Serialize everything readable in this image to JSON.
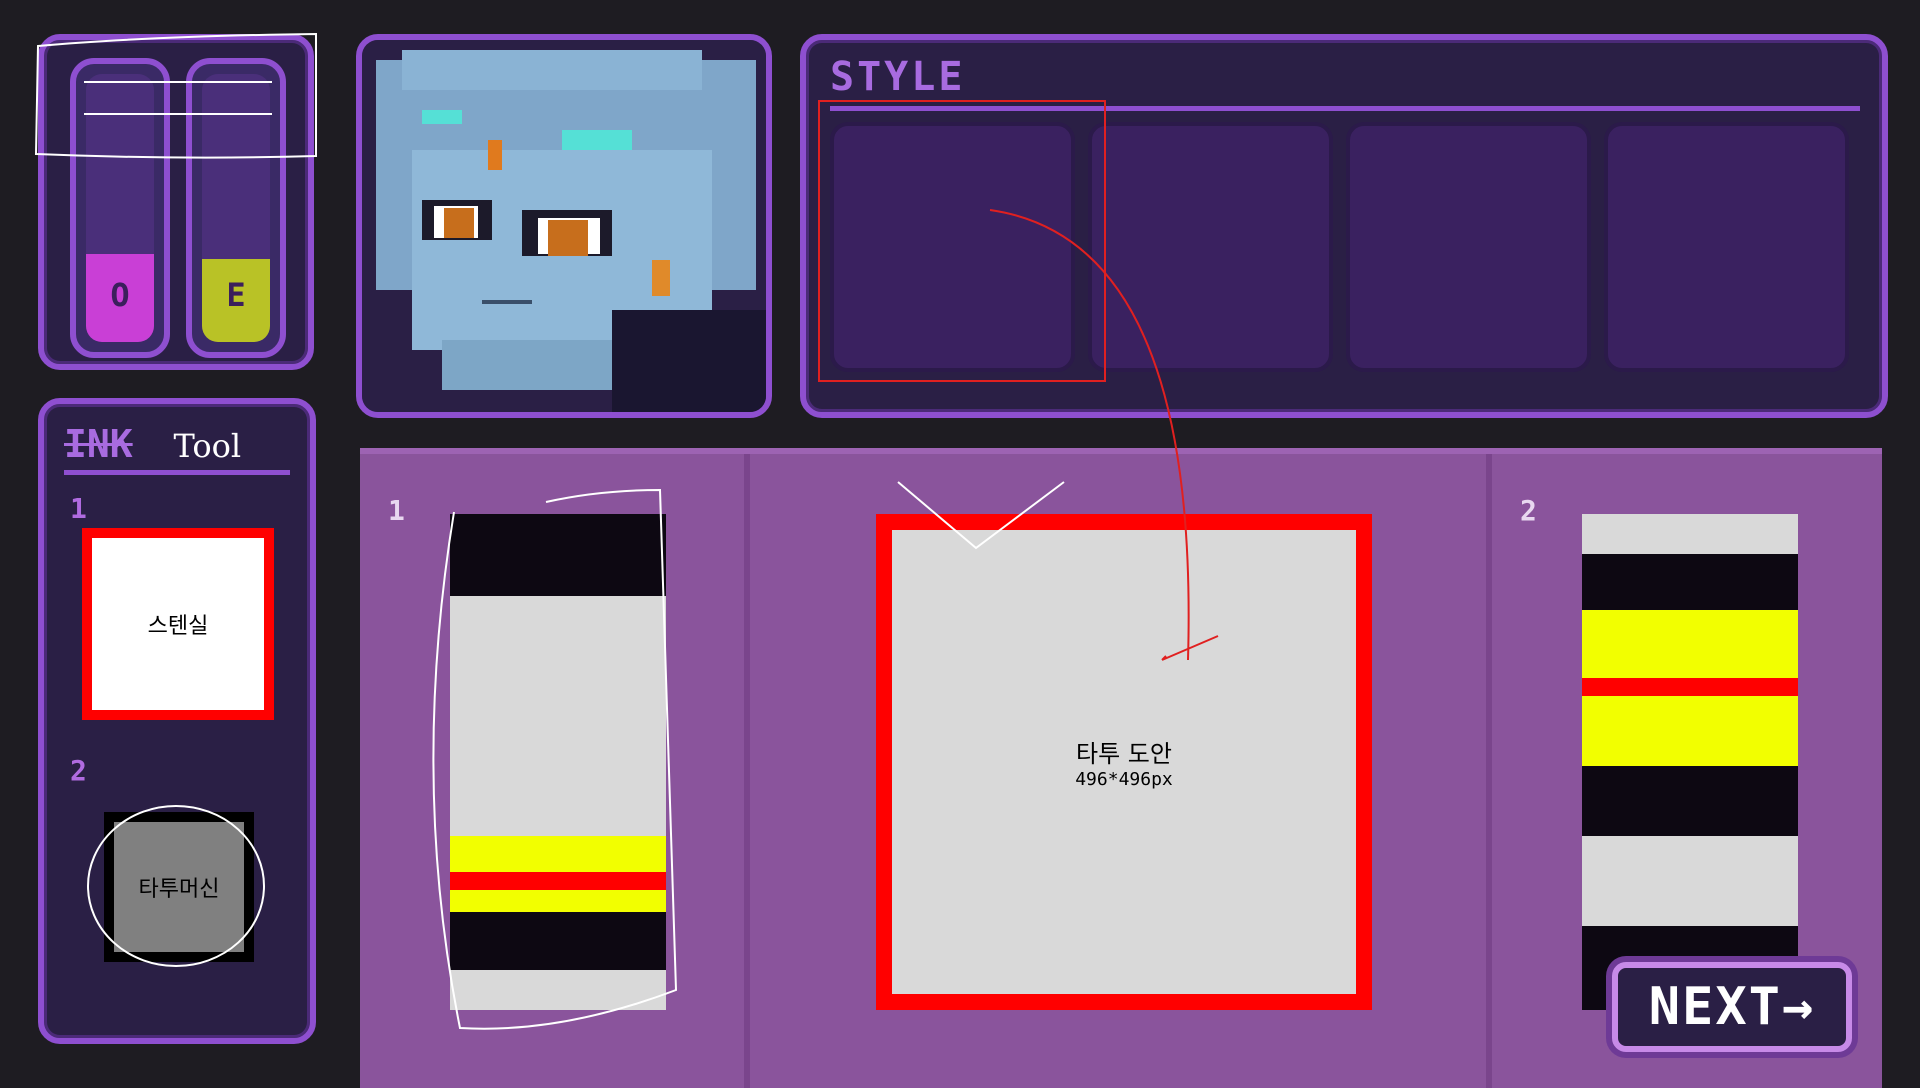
{
  "ink": {
    "tubes": [
      {
        "letter": "O",
        "fill_color": "#c93fd6",
        "level": 0.33
      },
      {
        "letter": "E",
        "fill_color": "#b9c226",
        "level": 0.31
      }
    ]
  },
  "tools": {
    "title_strike": "INK",
    "title": "Tool",
    "items": [
      {
        "number": "1",
        "label": "스텐실"
      },
      {
        "number": "2",
        "label": "타투머신"
      }
    ]
  },
  "style": {
    "title": "STYLE",
    "slot_count": 4
  },
  "workspace": {
    "left_number": "1",
    "right_number": "2",
    "canvas_title": "타투 도안",
    "canvas_size": "496*496px"
  },
  "next_label": "NEXT→",
  "colors": {
    "accent": "#8e4fd0",
    "panel_bg": "#2a1f45",
    "work_bg": "#8a549c",
    "highlight_red": "#ff0000",
    "yellow": "#f2ff00",
    "dark": "#0d0812",
    "light": "#d9d9d9"
  }
}
